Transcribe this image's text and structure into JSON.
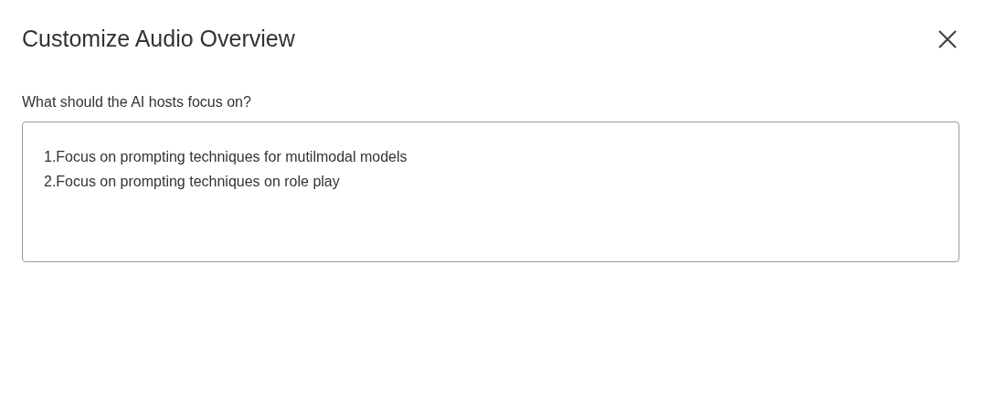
{
  "dialog": {
    "title": "Customize Audio Overview"
  },
  "prompt": {
    "label": "What should the AI hosts focus on?",
    "value": "1.Focus on prompting techniques for mutilmodal models\n2.Focus on prompting techniques on role play"
  }
}
